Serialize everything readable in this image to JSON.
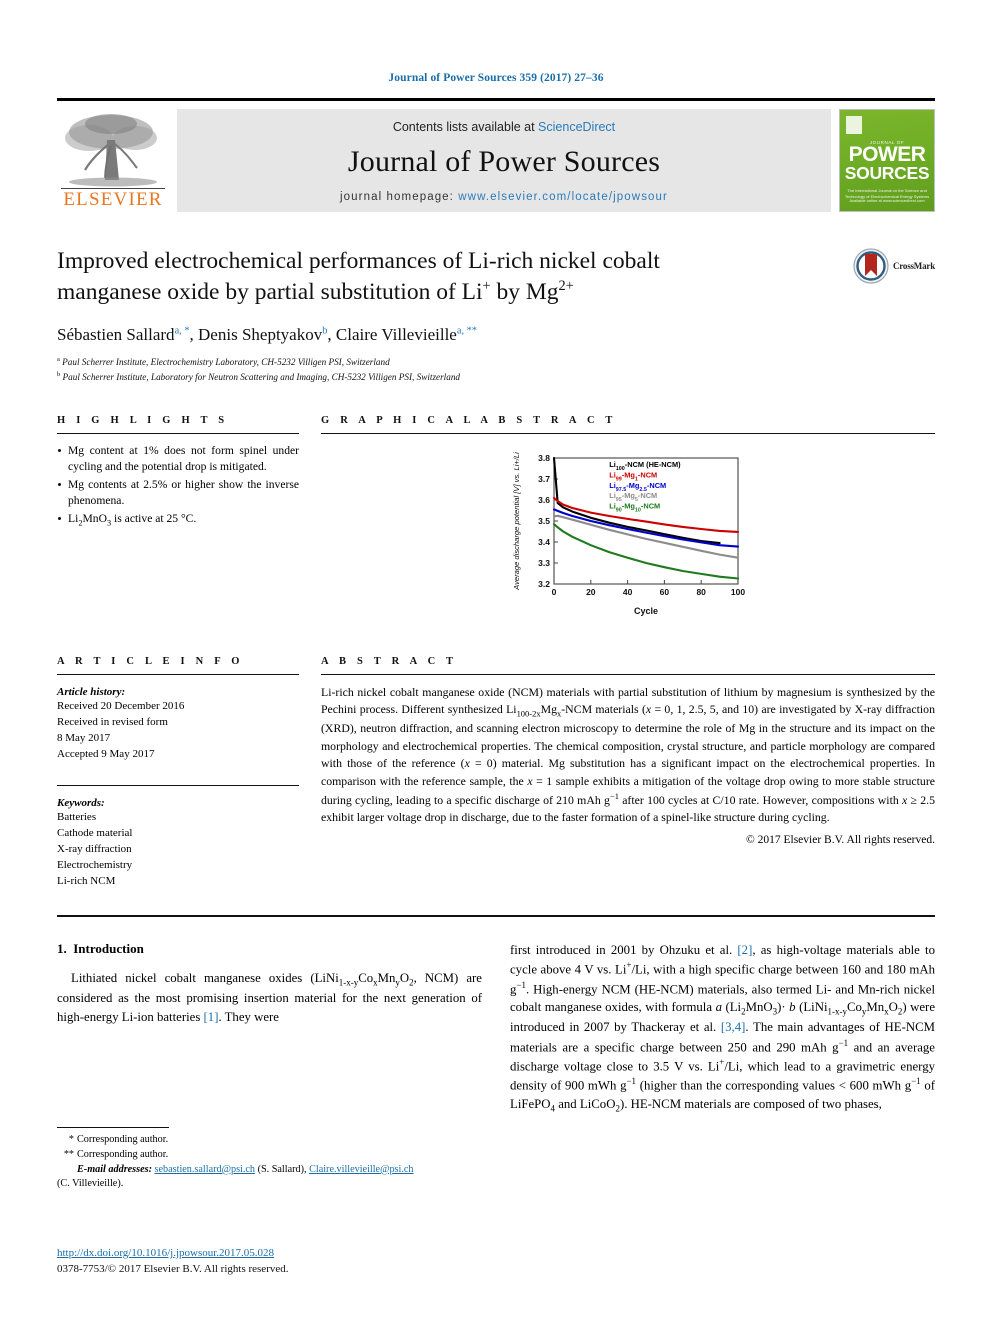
{
  "running_head": "Journal of Power Sources 359 (2017) 27–36",
  "banner": {
    "contents_prefix": "Contents lists available at ",
    "contents_link": "ScienceDirect",
    "journal_title": "Journal of Power Sources",
    "homepage_prefix": "journal homepage: ",
    "homepage_url": "www.elsevier.com/locate/jpowsour",
    "publisher": "ELSEVIER",
    "cover": {
      "kicker": "JOURNAL OF",
      "line1": "POWER",
      "line2": "SOURCES",
      "sub": "The International Journal on the Science and Technology of Electrochemical Energy Systems",
      "foot": "Available online at www.sciencedirect.com"
    }
  },
  "article": {
    "title_line1": "Improved electrochemical performances of Li-rich nickel cobalt",
    "title_line2_pre": "manganese oxide by partial substitution of Li",
    "title_line2_sup1": "+",
    "title_line2_mid": " by Mg",
    "title_line2_sup2": "2+",
    "authors": [
      {
        "name": "Sébastien Sallard",
        "marks": "a, *"
      },
      {
        "name": "Denis Sheptyakov",
        "marks": "b"
      },
      {
        "name": "Claire Villevieille",
        "marks": "a, **"
      }
    ],
    "affiliations": [
      {
        "mark": "a",
        "text": "Paul Scherrer Institute, Electrochemistry Laboratory, CH-5232 Villigen PSI, Switzerland"
      },
      {
        "mark": "b",
        "text": "Paul Scherrer Institute, Laboratory for Neutron Scattering and Imaging, CH-5232 Villigen PSI, Switzerland"
      }
    ],
    "crossmark_label": "CrossMark"
  },
  "highlights": {
    "heading": "H I G H L I G H T S",
    "items": [
      "Mg content at 1% does not form spinel under cycling and the potential drop is mitigated.",
      "Mg contents at 2.5% or higher show the inverse phenomena.",
      "Li2MnO3 is active at 25 °C."
    ]
  },
  "graphical_abstract": {
    "heading": "G R A P H I C A L   A B S T R A C T"
  },
  "chart_data": {
    "type": "line",
    "title": "",
    "xlabel": "Cycle",
    "ylabel": "Average discharge potential [V] vs. Li+/Li",
    "xlim": [
      0,
      100
    ],
    "ylim": [
      3.2,
      3.8
    ],
    "xticks": [
      0,
      20,
      40,
      60,
      80,
      100
    ],
    "yticks": [
      "3.2",
      "3.3",
      "3.4",
      "3.5",
      "3.6",
      "3.7",
      "3.8"
    ],
    "grid": false,
    "legend_position": "top-right",
    "series": [
      {
        "name": "Li100-NCM (HE-NCM)",
        "color": "#000000",
        "x": [
          0,
          2,
          5,
          10,
          20,
          30,
          40,
          50,
          60,
          70,
          80,
          90
        ],
        "values": [
          3.8,
          3.585,
          3.565,
          3.545,
          3.515,
          3.492,
          3.472,
          3.455,
          3.437,
          3.42,
          3.405,
          3.395
        ]
      },
      {
        "name": "Li99-Mg1-NCM",
        "color": "#cc0000",
        "x": [
          0,
          2,
          5,
          10,
          20,
          30,
          40,
          50,
          60,
          70,
          80,
          90,
          100
        ],
        "values": [
          3.61,
          3.595,
          3.578,
          3.562,
          3.54,
          3.524,
          3.51,
          3.497,
          3.484,
          3.472,
          3.462,
          3.453,
          3.448
        ]
      },
      {
        "name": "Li97.5-Mg2.5-NCM",
        "color": "#0000cc",
        "x": [
          0,
          2,
          5,
          10,
          20,
          30,
          40,
          50,
          60,
          70,
          80,
          90,
          100
        ],
        "values": [
          3.555,
          3.548,
          3.538,
          3.524,
          3.5,
          3.48,
          3.462,
          3.445,
          3.428,
          3.412,
          3.398,
          3.385,
          3.378
        ]
      },
      {
        "name": "Li95-Mg5-NCM",
        "color": "#8c8c8c",
        "x": [
          0,
          2,
          5,
          10,
          20,
          30,
          40,
          50,
          60,
          70,
          80,
          90,
          100
        ],
        "values": [
          3.522,
          3.525,
          3.518,
          3.506,
          3.482,
          3.458,
          3.436,
          3.415,
          3.396,
          3.377,
          3.358,
          3.34,
          3.325
        ]
      },
      {
        "name": "Li90-Mg10-NCM",
        "color": "#1e7a1e",
        "x": [
          0,
          2,
          5,
          10,
          20,
          30,
          40,
          50,
          60,
          70,
          80,
          90,
          100
        ],
        "values": [
          3.485,
          3.47,
          3.45,
          3.425,
          3.385,
          3.352,
          3.325,
          3.3,
          3.28,
          3.262,
          3.248,
          3.235,
          3.226
        ]
      }
    ],
    "legend": [
      {
        "prefix": "Li",
        "sub1": "100",
        "rest": "-NCM (HE-NCM)",
        "color": "#000000"
      },
      {
        "prefix": "Li",
        "sub1": "99",
        "rest": "-Mg",
        "sub2": "1",
        "tail": "-NCM",
        "color": "#cc0000"
      },
      {
        "prefix": "Li",
        "sub1": "97.5",
        "rest": "-Mg",
        "sub2": "2.5",
        "tail": "-NCM",
        "color": "#0000cc"
      },
      {
        "prefix": "Li",
        "sub1": "95",
        "rest": "-Mg",
        "sub2": "5",
        "tail": "-NCM",
        "color": "#8c8c8c"
      },
      {
        "prefix": "Li",
        "sub1": "90",
        "rest": "-Mg",
        "sub2": "10",
        "tail": "-NCM",
        "color": "#1e7a1e"
      }
    ]
  },
  "article_info": {
    "heading": "A R T I C L E   I N F O",
    "history_label": "Article history:",
    "history_lines": [
      "Received 20 December 2016",
      "Received in revised form",
      "8 May 2017",
      "Accepted 9 May 2017"
    ],
    "keywords_label": "Keywords:",
    "keywords": [
      "Batteries",
      "Cathode material",
      "X-ray diffraction",
      "Electrochemistry",
      "Li-rich NCM"
    ]
  },
  "abstract": {
    "heading": "A B S T R A C T",
    "text": "Li-rich nickel cobalt manganese oxide (NCM) materials with partial substitution of lithium by magnesium is synthesized by the Pechini process. Different synthesized Li100-2xMgx-NCM materials (x = 0, 1, 2.5, 5, and 10) are investigated by X-ray diffraction (XRD), neutron diffraction, and scanning electron microscopy to determine the role of Mg in the structure and its impact on the morphology and electrochemical properties. The chemical composition, crystal structure, and particle morphology are compared with those of the reference (x = 0) material. Mg substitution has a significant impact on the electrochemical properties. In comparison with the reference sample, the x = 1 sample exhibits a mitigation of the voltage drop owing to more stable structure during cycling, leading to a specific discharge of 210 mAh g−1 after 100 cycles at C/10 rate. However, compositions with x ≥ 2.5 exhibit larger voltage drop in discharge, due to the faster formation of a spinel-like structure during cycling.",
    "copyright": "© 2017 Elsevier B.V. All rights reserved."
  },
  "introduction": {
    "section_number": "1.",
    "section_title": "Introduction",
    "left_paragraph": "Lithiated nickel cobalt manganese oxides (LiNi1-x-yCoxMnyO2, NCM) are considered as the most promising insertion material for the next generation of high-energy Li-ion batteries [1]. They were",
    "right_paragraph": "first introduced in 2001 by Ohzuku et al. [2], as high-voltage materials able to cycle above 4 V vs. Li+/Li, with a high specific charge between 160 and 180 mAh g−1. High-energy NCM (HE-NCM) materials, also termed Li- and Mn-rich nickel cobalt manganese oxides, with formula a (Li2MnO3)· b (LiNi1-x-yCoyMnxO2) were introduced in 2007 by Thackeray et al. [3,4]. The main advantages of HE-NCM materials are a specific charge between 250 and 290 mAh g−1 and an average discharge voltage close to 3.5 V vs. Li+/Li, which lead to a gravimetric energy density of 900 mWh g−1 (higher than the corresponding values < 600 mWh g−1 of LiFePO4 and LiCoO2). HE-NCM materials are composed of two phases,"
  },
  "footnotes": {
    "corresponding1": {
      "mark": "*",
      "text": "Corresponding author."
    },
    "corresponding2": {
      "mark": "**",
      "text": "Corresponding author."
    },
    "email_label": "E-mail addresses:",
    "email1": "sebastien.sallard@psi.ch",
    "email1_name": "(S. Sallard),",
    "email2": "Claire.villevieille@psi.ch",
    "email2_name": "(C. Villevieille)."
  },
  "doi": {
    "url": "http://dx.doi.org/10.1016/j.jpowsour.2017.05.028",
    "issn_line": "0378-7753/© 2017 Elsevier B.V. All rights reserved."
  }
}
